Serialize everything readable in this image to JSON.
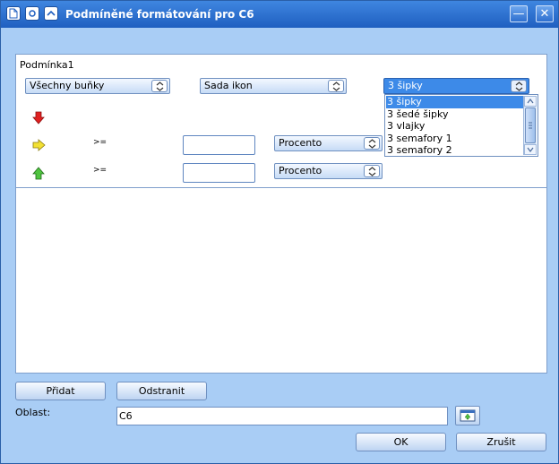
{
  "window": {
    "title": "Podmíněné formátování pro C6",
    "controls": {
      "minimize": "—",
      "close": "✕"
    }
  },
  "condition": {
    "label": "Podmínka1",
    "apply_to": "Všechny buňky",
    "type": "Sada ikon",
    "icon_set": "3 šipky",
    "rows": [
      {
        "icon": "red-arrow-down-icon",
        "op": "",
        "unit": ""
      },
      {
        "icon": "yellow-arrow-right-icon",
        "op": ">=",
        "unit": "Procento"
      },
      {
        "icon": "green-arrow-up-icon",
        "op": ">=",
        "unit": "Procento"
      }
    ],
    "dropdown_options": [
      "3 šipky",
      "3 šedé šipky",
      "3 vlajky",
      "3 semafory 1",
      "3 semafory 2"
    ]
  },
  "buttons": {
    "add": "Přidat",
    "remove": "Odstranit",
    "ok": "OK",
    "cancel": "Zrušit"
  },
  "range": {
    "label": "Oblast:",
    "value": "C6"
  },
  "colors": {
    "window_bg": "#a9cdf5",
    "title_bg": "#2e6fcf",
    "selection": "#3d8ae8",
    "arrow_down": "#e02020",
    "arrow_right": "#f2e033",
    "arrow_up": "#4fc43f"
  }
}
